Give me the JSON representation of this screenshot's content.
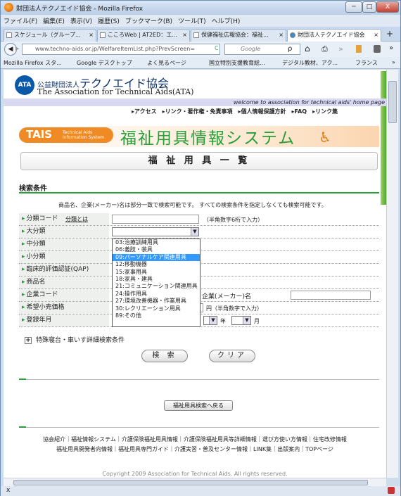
{
  "window": {
    "title": "財団法人テクノエイド協会 - Mozilla Firefox",
    "btn_min": "─",
    "btn_max": "□",
    "btn_close": "X"
  },
  "menu": [
    "ファイル(F)",
    "編集(E)",
    "表示(V)",
    "履歴(S)",
    "ブックマーク(B)",
    "ツール(T)",
    "ヘルプ(H)"
  ],
  "tabs": [
    {
      "label": "スケジュール（グループ..."
    },
    {
      "label": "こころWeb | AT2ED：エ..."
    },
    {
      "label": "保健福祉広報協会：福祉..."
    },
    {
      "label": "財団法人テクノエイド協会"
    }
  ],
  "tab_close": "×",
  "tab_new": "+",
  "nav": {
    "back": "◀",
    "forward": "▶",
    "url": "www.techno-aids.or.jp/WelfareItemList.php?PrevScreen=",
    "reload": "C",
    "search_engine": "Google",
    "search_placeholder": "Google",
    "search_icon": "ρ",
    "home": "⌂",
    "print": "⎙",
    "rss": "»",
    "menu_more": "»"
  },
  "bookmarks": [
    "Mozilla Firefox スタ...",
    "Google デスクトップ",
    "よく見るページ",
    "国立特別支援教育総...",
    "デジタル教材、アク...",
    "フランス"
  ],
  "bookmarks_more": "»",
  "header": {
    "logo": "ATA",
    "org_prefix": "公益財団法人",
    "org_name": "テクノエイド協会",
    "org_en": "The Association for Technical Aids(ATA)",
    "welcome": "welcome to association for technical aids' home page",
    "links": [
      "アクセス",
      "リンク・著作権・免責事項",
      "個人情報保護方針",
      "FAQ",
      "リンク集"
    ]
  },
  "tais": {
    "label": "TAIS",
    "sub1": "Technical Aids",
    "sub2": "Information System",
    "system_name": "福祉用具情報システム"
  },
  "page_title": "福 祉 用 具 一 覧",
  "search": {
    "section_title": "検索条件",
    "note": "商品名、企業(メーカー)名は部分一致で検索可能です。 すべての検索条件を指定しなくても検索可能です。",
    "fields": {
      "code": "分類コード",
      "code_link": "分類とは",
      "code_hint": "（半角数字6桁で入力）",
      "major": "大分類",
      "middle": "中分類",
      "minor": "小分類",
      "qap": "臨床的評価認証(QAP)",
      "product": "商品名",
      "company_code": "企業コード",
      "company_name": "企業(メーカー)名",
      "price": "希望小売価格",
      "price_hint": "円（半角数字で入力）",
      "reg_date": "登録年月",
      "year": "年",
      "month": "月"
    },
    "dropdown_options": [
      "03:治療訓練用具",
      "06:義肢・装具",
      "09:パーソナルケア関連用具",
      "12:移動機器",
      "15:家事用具",
      "18:家具・建具",
      "21:コミュニケーション関連用具",
      "24:操作用具",
      "27:環境改善機器・作業用具",
      "30:レクリエーション用具",
      "89:その他"
    ],
    "dropdown_highlighted": "09:パーソナルケア関連用具",
    "expand_label": "特殊寝台・車いす詳細検索条件",
    "expand_icon": "+",
    "search_btn": "検 索",
    "clear_btn": "クリア"
  },
  "back_btn": "福祉用具検索へ戻る",
  "footer": {
    "row1": "協会紹介｜福祉情報システム｜介護保険福祉用具情報｜介護保険福祉用具等詳細情報｜選び方使い方情報｜住宅改修情報",
    "row2": "福祉用具開発者向情報｜福祉用具専門ガイド｜介護実習・普及センター情報｜LINK集｜出版案内｜TOPページ",
    "copyright": "Copyright 2009 Association for Technical Aids. All rights reserved."
  },
  "statusbar": {
    "close": "x"
  }
}
